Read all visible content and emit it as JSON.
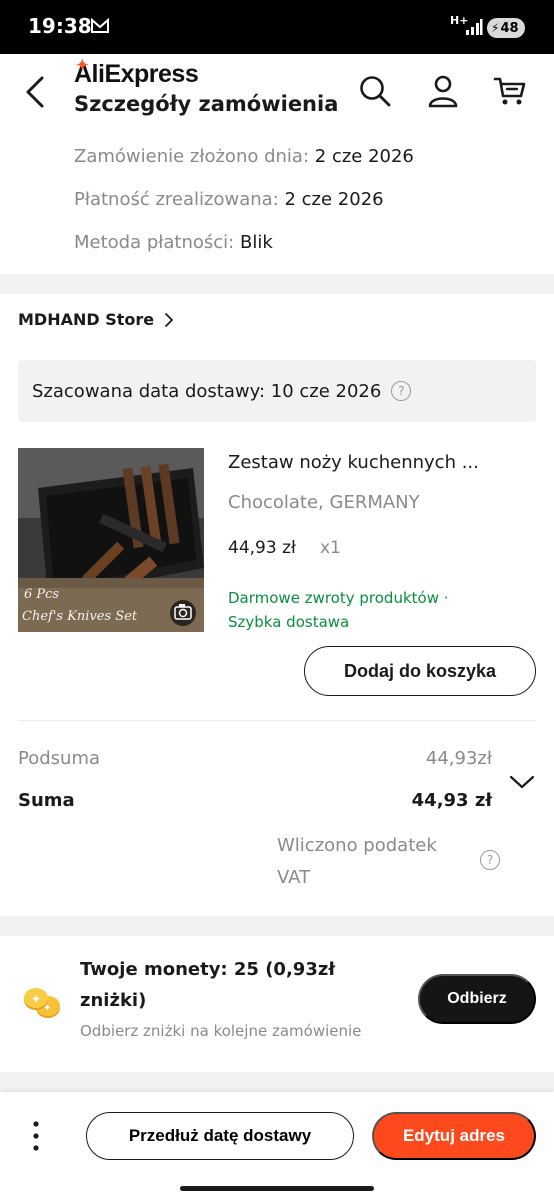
{
  "status_bar": {
    "time": "19:38",
    "network": "H+",
    "battery": "48"
  },
  "header": {
    "brand": "AliExpress",
    "title": "Szczegóły zamówienia"
  },
  "order_info": {
    "placed_label": "Zamówienie złożono dnia:",
    "placed_value": "2 cze 2026",
    "paid_label": "Płatność zrealizowana:",
    "paid_value": "2 cze 2026",
    "method_label": "Metoda płatności:",
    "method_value": "Blik"
  },
  "store": {
    "name": "MDHAND Store"
  },
  "delivery": {
    "estimate": "Szacowana data dostawy: 10 cze 2026"
  },
  "product": {
    "title": "Zestaw noży kuchennych ...",
    "variant": "Chocolate, GERMANY",
    "price": "44,93 zł",
    "quantity": "x1",
    "perks_line1": "Darmowe zwroty produktów ·",
    "perks_line2": "Szybka dostawa",
    "image_caption_line1": "6 Pcs",
    "image_caption_line2": "Chef's Knives Set",
    "add_to_cart_label": "Dodaj do koszyka"
  },
  "totals": {
    "subtotal_label": "Podsuma",
    "subtotal_value": "44,93zł",
    "total_label": "Suma",
    "total_value": "44,93 zł",
    "vat_note": "Wliczono podatek VAT"
  },
  "coins": {
    "title": "Twoje monety: 25 (0,93zł zniżki)",
    "subtitle": "Odbierz zniżki na kolejne zamówienie",
    "claim_label": "Odbierz"
  },
  "bottom_bar": {
    "extend_label": "Przedłuż datę dostawy",
    "edit_address_label": "Edytuj adres"
  },
  "colors": {
    "accent": "#fd4a1c",
    "green": "#0a8f3f",
    "muted": "#8a8a8a",
    "gap": "#f2f2f2"
  },
  "icons": [
    "back-arrow-icon",
    "search-icon",
    "account-icon",
    "cart-icon",
    "chevron-right-icon",
    "help-circle-icon",
    "camera-icon",
    "chevron-down-icon",
    "coins-icon",
    "more-vertical-icon"
  ]
}
